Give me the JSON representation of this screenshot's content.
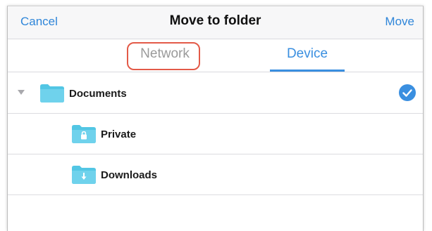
{
  "header": {
    "cancel_label": "Cancel",
    "title": "Move to folder",
    "move_label": "Move"
  },
  "tabs": [
    {
      "label": "Network",
      "selected": false,
      "highlighted": true
    },
    {
      "label": "Device",
      "selected": true
    }
  ],
  "folders": [
    {
      "name": "Documents",
      "icon": "folder-icon",
      "expanded": true,
      "checked": true,
      "level": 0
    },
    {
      "name": "Private",
      "icon": "folder-lock-icon",
      "level": 1
    },
    {
      "name": "Downloads",
      "icon": "folder-download-icon",
      "level": 1
    }
  ],
  "colors": {
    "accent": "#2f86d9",
    "folder": "#52c6e4",
    "highlight_border": "#e35a48",
    "inactive_tab": "#9a9a9a"
  }
}
